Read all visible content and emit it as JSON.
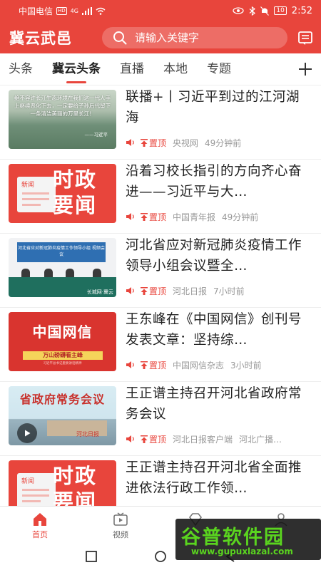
{
  "status_bar": {
    "carrier": "中国电信",
    "network_badge": "HD",
    "signal": "4G",
    "battery": "10",
    "time": "2:52"
  },
  "header": {
    "app_title": "冀云武邑",
    "search_placeholder": "请输入关键字",
    "right_icon": "message-icon"
  },
  "tabs": [
    {
      "label": "头条",
      "active": false
    },
    {
      "label": "冀云头条",
      "active": true
    },
    {
      "label": "直播",
      "active": false
    },
    {
      "label": "本地",
      "active": false
    },
    {
      "label": "专题",
      "active": false
    }
  ],
  "news": [
    {
      "title": "联播+丨习近平到过的江河湖海",
      "pin": "置顶",
      "source": "央视网",
      "time": "49分钟前",
      "thumb": {
        "type": "landscape-quote",
        "text": "绝不容许长江生态环境在我们这一代人手上继续恶化下去，一定要给子孙后代留下一条清洁美丽的万里长江！",
        "signature": "——习近平"
      }
    },
    {
      "title": "沿着习校长指引的方向齐心奋进——习近平与大…",
      "pin": "置顶",
      "source": "中国青年报",
      "time": "49分钟前",
      "thumb": {
        "type": "shizheng",
        "label": "新闻",
        "big_line1": "时政",
        "big_line2": "要闻"
      }
    },
    {
      "title": "河北省应对新冠肺炎疫情工作领导小组会议暨全…",
      "pin": "置顶",
      "source": "河北日报",
      "time": "7小时前",
      "thumb": {
        "type": "meeting",
        "banner": "河北省应对新冠肺炎疫情工作领导小组 视频会议",
        "caption": "长城网·冀云"
      }
    },
    {
      "title": "王东峰在《中国网信》创刊号发表文章：坚持综…",
      "pin": "置顶",
      "source": "中国网信杂志",
      "time": "3小时前",
      "thumb": {
        "type": "cyber",
        "big": "中国网信",
        "tagline": "万山磅礴看主峰",
        "sub": "习近平总书记重要讲话精神"
      }
    },
    {
      "title": "王正谱主持召开河北省政府常务会议",
      "pin": "置顶",
      "source": "河北日报客户端",
      "time": "河北广播…",
      "thumb": {
        "type": "gov",
        "big": "省政府常务会议",
        "paper": "河北日报"
      }
    },
    {
      "title": "王正谱主持召开河北省全面推进依法行政工作领…",
      "pin": "",
      "source": "",
      "time": "",
      "thumb": {
        "type": "shizheng",
        "label": "新闻",
        "big_line1": "时政",
        "big_line2": "要闻"
      }
    }
  ],
  "bottom_nav": [
    {
      "label": "首页",
      "icon": "home-icon",
      "active": true
    },
    {
      "label": "视频",
      "icon": "video-icon",
      "active": false
    },
    {
      "label": "",
      "icon": "diamond-icon",
      "active": false
    },
    {
      "label": "",
      "icon": "user-icon",
      "active": false
    }
  ],
  "watermark": {
    "main": "谷普软件园",
    "url": "www.gupuxlazal.com"
  },
  "colors": {
    "accent": "#e8453c",
    "text": "#222222",
    "meta": "#999999"
  }
}
